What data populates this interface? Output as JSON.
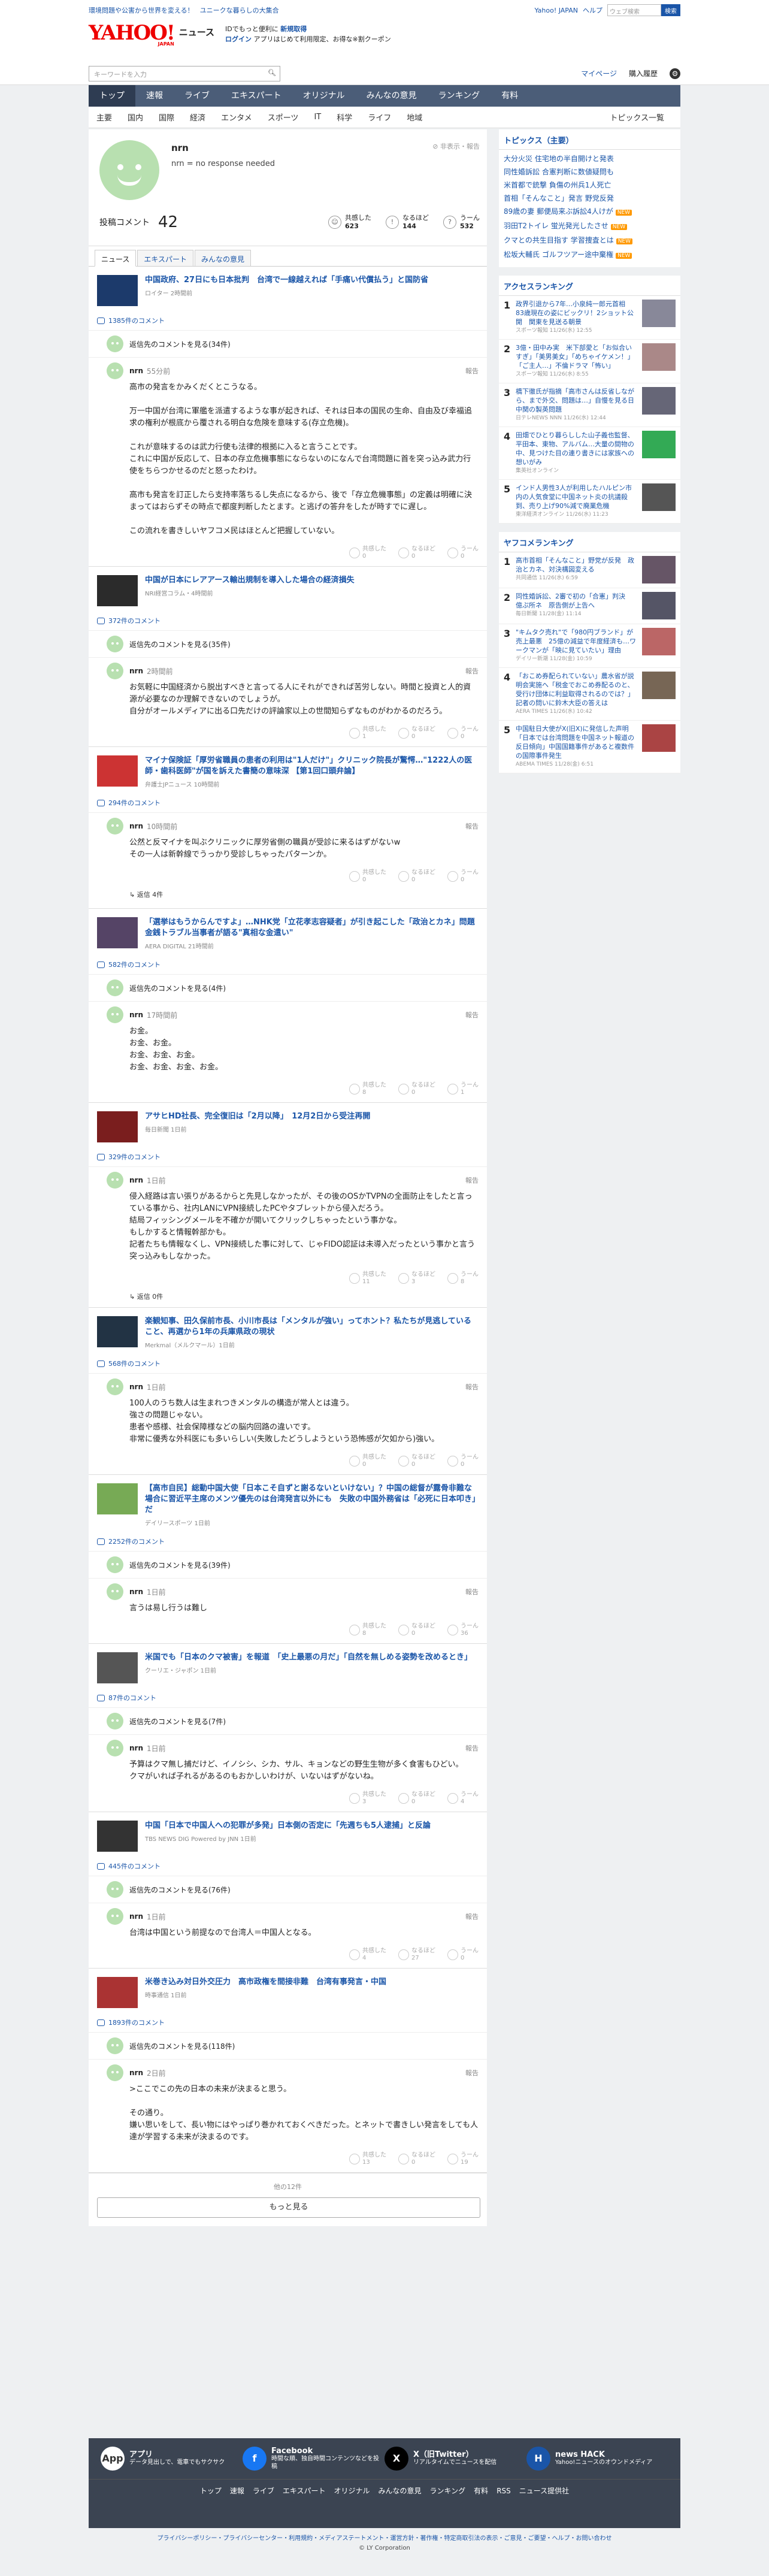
{
  "topbar": {
    "links": [
      "環境問題や公害から世界を変える！",
      "ユニークな暮らしの大集合"
    ],
    "yahoo_japan": "Yahoo! JAPAN",
    "help": "ヘルプ",
    "search_placeholder": "ウェブ検索",
    "search_btn": "検索"
  },
  "header": {
    "logo": "YAHOO!",
    "logo_sub": "JAPAN",
    "news": "ニュース",
    "line1a": "IDでもっと便利に",
    "line1b": "新規取得",
    "line2a": "ログイン",
    "line2b": "アプリはじめて利用限定、お得な※割クーポン"
  },
  "searchrow": {
    "placeholder": "キーワードを入力",
    "mypage": "マイページ",
    "buy": "購入履歴"
  },
  "gnav": [
    "トップ",
    "速報",
    "ライブ",
    "エキスパート",
    "オリジナル",
    "みんなの意見",
    "ランキング",
    "有料"
  ],
  "subnav": [
    "主要",
    "国内",
    "国際",
    "経済",
    "エンタメ",
    "スポーツ",
    "IT",
    "科学",
    "ライフ",
    "地域"
  ],
  "subnav_more": "トピックス一覧",
  "profile": {
    "name": "nrn",
    "desc": "nrn = no response needed",
    "report": "非表示・報告",
    "comments_label": "投稿コメント",
    "comments": "42",
    "stats": [
      {
        "label": "共感した",
        "value": "623"
      },
      {
        "label": "なるほど",
        "value": "144"
      },
      {
        "label": "うーん",
        "value": "532"
      }
    ]
  },
  "tabs": [
    "ニュース",
    "エキスパート",
    "みんなの意見"
  ],
  "report": "報告",
  "show_replies": "返信",
  "show_replies_count": "件",
  "posts": [
    {
      "title": "中国政府、27日にも日本批判　台湾で一線越えれば「手痛い代償払う」と国防省",
      "source": "ロイター 2時間前",
      "cc": "1385件のコメント",
      "reply_to": "返信先のコメントを見る(34件)",
      "time": "55分前",
      "body": "高市の発言をかみくだくとこうなる。\n\n万一中国が台湾に軍艦を派遣するような事が起きれば、それは日本の国民の生命、自由及び幸福追求の権利が根底から覆される明白な危険を意味する(存立危機)。\n\nこれが意味するのは武力行使も法律的根拠に入ると言うことです。\nこれに中国が反応して、日本の存立危機事態にならないのになんで台湾問題に首を突っ込み武力行使をちらつかせるのだと怒ったわけ。\n\n高市も発言を訂正したら支持率落ちるし失点になるから、後で「存立危機事態」の定義は明確に決まってはおらずその時点で都度判断したとます。と逃げの答弁をしたが時すでに遅し。\n\nこの流れを書きしいヤフコメ民はほとんど把握していない。",
      "r": [
        "0",
        "0",
        "0"
      ]
    },
    {
      "title": "中国が日本にレアアース輸出規制を導入した場合の経済損失",
      "source": "NRI経営コラム・4時間前",
      "cc": "372件のコメント",
      "reply_to": "返信先のコメントを見る(35件)",
      "time": "2時間前",
      "body": "お気軽に中国経済から脱出すべきと言ってる人にそれができれば苦労しない。時間と投資と人的資源が必要なのか理解できないのでしょうが。\n自分がオールメディアに出る口先だけの評論家以上の世間知らずなものがわかるのだろう。",
      "r": [
        "1",
        "0",
        "0"
      ]
    },
    {
      "title": "マイナ保険証「厚労省職員の患者の利用は\"1人だけ\"」クリニック院長が驚愕…\"1222人の医師・歯科医師\"が国を訴えた書簡の意味深 【第1回口頭弁論】",
      "source": "弁護士JPニュース 10時間前",
      "cc": "294件のコメント",
      "reply_to": "",
      "time": "10時間前",
      "body": "公然と反マイナを叫ぶクリニックに厚労省側の職員が受診に来るはずがないw\nその一人は新幹線でうっかり受診しちゃったパターンか。",
      "r": [
        "0",
        "0",
        "0"
      ],
      "replies": "返信 4件"
    },
    {
      "title": "「選挙はもうからんですよ」…NHK党「立花孝志容疑者」が引き起こした「政治とカネ」問題　金銭トラブル当事者が語る\"真相な金遣い\"",
      "source": "AERA DIGITAL 21時間前",
      "cc": "582件のコメント",
      "reply_to": "返信先のコメントを見る(4件)",
      "time": "17時間前",
      "body": "お金。\nお金、お金。\nお金、お金、お金。\nお金、お金、お金、お金。",
      "r": [
        "8",
        "0",
        "1"
      ]
    },
    {
      "title": "アサヒHD社長、完全復旧は「2月以降」　12月2日から受注再開",
      "source": "毎日新聞 1日前",
      "cc": "329件のコメント",
      "reply_to": "",
      "time": "1日前",
      "body": "侵入経路は言い張りがあるからと先見しなかったが、その後のOSかTVPNの全面防止をしたと言っている事から、社内LANにVPN接続したPCやタブレットから侵入だろう。\n結局フィッシングメールを不確かが開いてクリックしちゃったという事かな。\nもしかすると情報幹部かも。\n記者たちも情報なくし、VPN接続した事に対して、じゃFIDO認証は未導入だったという事かと言う突っ込みもしなかった。",
      "r": [
        "11",
        "3",
        "8"
      ],
      "replies": "返信 0件"
    },
    {
      "title": "楽観知事、田久保前市長、小川市長は「メンタルが強い」ってホント？私たちが見逃していること、再選から1年の兵庫県政の現状",
      "source": "Merkmal（メルクマール）1日前",
      "cc": "568件のコメント",
      "reply_to": "",
      "time": "1日前",
      "body": "100人のうち数人は生まれつきメンタルの構造が常人とは違う。\n強さの問題じゃない。\n患者や感様、社会保障様などの脳内回路の違いです。\n非常に優秀な外科医にも多いらしい(失敗したどうしようという恐怖感が欠如から)強い。",
      "r": [
        "0",
        "0",
        "0"
      ]
    },
    {
      "title": "【高市自民】総動中国大使「日本こそ自ずと謝るないといけない」？中国の総督が露骨非難な場合に習近平主席のメンツ優先のは台湾発言以外にも　失敗の中国外務省は「必死に日本叩き」だ",
      "source": "デイリースポーツ 1日前",
      "cc": "2252件のコメント",
      "reply_to": "返信先のコメントを見る(39件)",
      "time": "1日前",
      "body": "言うは易し行うは難し",
      "r": [
        "8",
        "0",
        "36"
      ]
    },
    {
      "title": "米国でも「日本のクマ被害」を報道　「史上最悪の月だ」「自然を無しめる姿勢を改めるとき」",
      "source": "クーリエ・ジャポン 1日前",
      "cc": "87件のコメント",
      "reply_to": "返信先のコメントを見る(7件)",
      "time": "1日前",
      "body": "予算はクマ無し捕だけど、イノシシ、シカ、サル、キョンなどの野生生物が多く食害もひどい。\nクマがいれば子れるがあるのもおかしいわけが、いないはずがないね。",
      "r": [
        "3",
        "0",
        "4"
      ]
    },
    {
      "title": "中国「日本で中国人への犯罪が多発」日本側の否定に「先週ちも5人逮捕」と反論",
      "source": "TBS NEWS DIG Powered by JNN 1日前",
      "cc": "445件のコメント",
      "reply_to": "返信先のコメントを見る(76件)",
      "time": "1日前",
      "body": "台湾は中国という前提なので台湾人＝中国人となる。",
      "r": [
        "4",
        "27",
        "0"
      ]
    },
    {
      "title": "米巻き込み対日外交圧力　高市政権を間接非難　台湾有事発言・中国",
      "source": "時事通信 1日前",
      "cc": "1893件のコメント",
      "reply_to": "返信先のコメントを見る(118件)",
      "time": "2日前",
      "body": ">ここでこの先の日本の未来が決まると思う。\n\nその通り。\n嫌い思いをして、長い物にはやっぱり巻かれておくべきだった。とネットで書きしい発言をしても人達が学習する未来が決まるのです。",
      "r": [
        "13",
        "0",
        "19"
      ]
    }
  ],
  "pager": {
    "count": "他の12件",
    "more": "もっと見る"
  },
  "side": {
    "topics_title": "トピックス（主要）",
    "topics": [
      "大分火災 住宅地の半自開けと発表",
      "同性婚訴訟 合憲判断に数値疑問も",
      "米首都で銃撃 負傷の州兵1人死亡",
      "首相「そんなこと」発言 野党反発",
      "89歳の妻 郵便局来ぶ訴訟4人けが",
      "羽田T2トイレ 蛍光発光したさせ",
      "クマとの共生目指す 学習捜査とは",
      "松坂大輔氏 ゴルフツアー途中棄権"
    ],
    "access_title": "アクセスランキング",
    "access": [
      {
        "t": "政界引退から7年…小泉純一郎元首相　83歳現在の姿にビックリ！2ショット公開　関東を見送る朝景",
        "s": "スポーツ報知 11/26(水) 12:55"
      },
      {
        "t": "3億・田中み実　米下部愛と「お似合いすぎ」「美男美女」「めちゃイケメン！」「ご主人…」不倫ドラマ「怖い」",
        "s": "スポーツ報知 11/26(水) 8:55"
      },
      {
        "t": "橋下徹氏が指摘「高市さんは反省しながら、まで外交、問題は…」自慢を見る日中関の製英問題",
        "s": "日テレNEWS NNN 11/26(水) 12:44"
      },
      {
        "t": "田畑でひとり暮らしした山子義也監督、平田本、東物、アルバム…大量の間物の中、見つけた目の連り書きには家族への想いがみ",
        "s": "集英社オンライン"
      },
      {
        "t": "インド人男性3人が利用したハルピン市内の人気食堂に中国ネット炎の抗議殺到、売り上げ90%減で廃業危機",
        "s": "東洋経済オンライン 11/26(水) 11:23"
      }
    ],
    "yahoo_title": "ヤフコメランキング",
    "yahoo": [
      {
        "t": "高市首相「そんなこと」野党が反発　政治とカネ、対決構図変える",
        "s": "共同通信 11/26(水) 6:59"
      },
      {
        "t": "同性婚訴訟、2審で初の「合憲」判決　億ぷ所ネ　原告側が上告へ",
        "s": "毎日新聞 11/28(金) 11:14"
      },
      {
        "t": "\"キムタク売れ\"で「980円ブランド」が売上最悪　25億の減益で年度経済も…ワークマンが「映に見ていたい」理由",
        "s": "デイリー新潮 11/28(金) 10:59"
      },
      {
        "t": "「おこめ券配られていない」農水省が説明会実施へ「税金でおこめ券配るのと、受行け団体に利益取得されるのでは？」記者の問いに鈴木大臣の答えは",
        "s": "AERA TIMES 11/26(水) 10:42"
      },
      {
        "t": "中国駐日大使がX(旧X)に発信した声明「日本では台湾問題を中国ネット報道の反日傾向」中国国籍事件があると複数件の国際事件発生",
        "s": "ABEMA TIMES 11/28(金) 6:51"
      }
    ]
  },
  "footer": {
    "boxes": [
      {
        "h": "アプリ",
        "d": "データ見出しで、電車でもサクサク",
        "i": "App"
      },
      {
        "h": "Facebook",
        "d": "時間な順、独自時間コンテンツなどを投稿",
        "i": "f"
      },
      {
        "h": "X（旧Twitter）",
        "d": "リアルタイムでニュースを配信",
        "i": "X"
      },
      {
        "h": "news HACK",
        "d": "Yahoo!ニュースのオウンドメディア",
        "i": "H"
      }
    ],
    "nav": [
      "トップ",
      "速報",
      "ライブ",
      "エキスパート",
      "オリジナル",
      "みんなの意見",
      "ランキング",
      "有料",
      "RSS",
      "ニュース提供社"
    ]
  },
  "legal": {
    "links": "プライバシーポリシー・プライバシーセンター・利用規約・メディアステートメント・運営方針・著作権・特定商取引法の表示・ご意見・ご要望・ヘルプ・お問い合わせ",
    "copy": "© LY Corporation"
  }
}
